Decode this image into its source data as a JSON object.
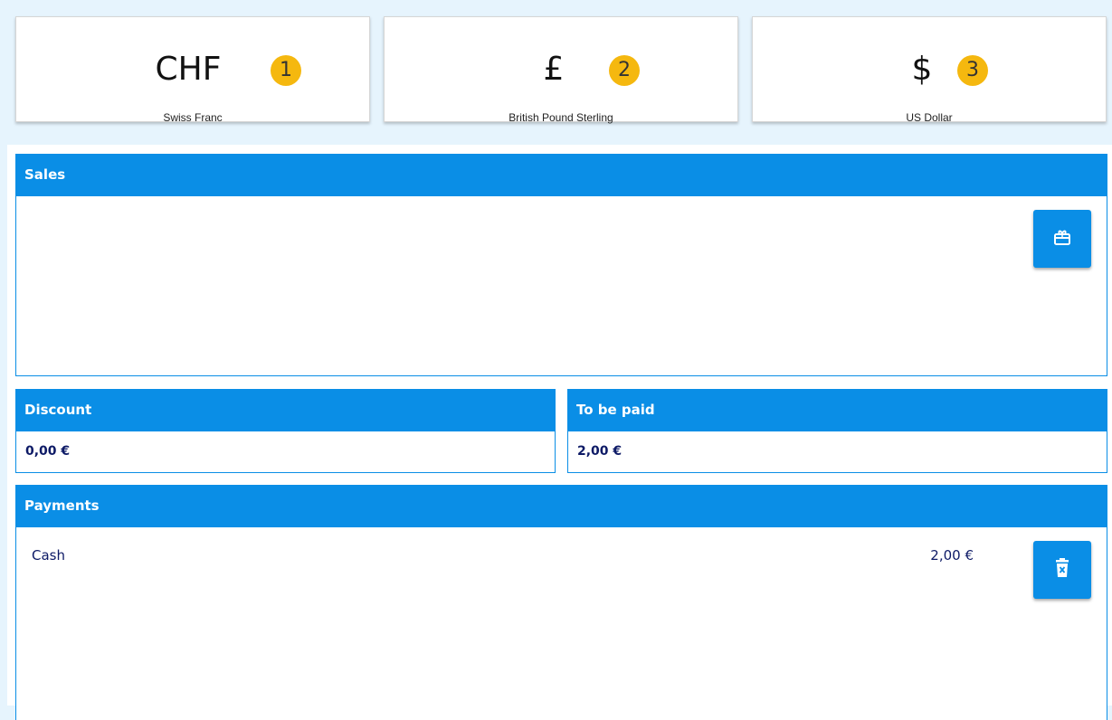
{
  "currencies": [
    {
      "symbol": "CHF",
      "badge": "1",
      "name": "Swiss Franc"
    },
    {
      "symbol": "£",
      "badge": "2",
      "name": "British Pound Sterling"
    },
    {
      "symbol": "$",
      "badge": "3",
      "name": "US Dollar"
    }
  ],
  "sales": {
    "title": "Sales",
    "button_icon": "gift-card-icon"
  },
  "discount": {
    "title": "Discount",
    "value": "0,00 €"
  },
  "to_be_paid": {
    "title": "To be paid",
    "value": "2,00 €"
  },
  "payments": {
    "title": "Payments",
    "items": [
      {
        "method": "Cash",
        "amount": "2,00 €"
      }
    ],
    "delete_icon": "trash-icon"
  },
  "colors": {
    "accent": "#0a8ee6",
    "badge": "#f5b80f",
    "value_text": "#0d1a66",
    "background": "#e6f4fd"
  }
}
